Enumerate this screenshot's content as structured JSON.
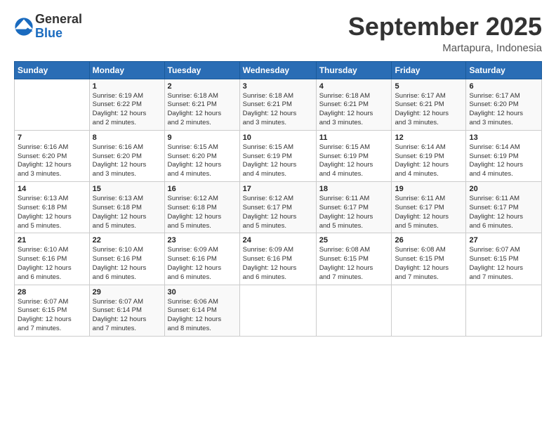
{
  "logo": {
    "general": "General",
    "blue": "Blue"
  },
  "title": "September 2025",
  "subtitle": "Martapura, Indonesia",
  "days_of_week": [
    "Sunday",
    "Monday",
    "Tuesday",
    "Wednesday",
    "Thursday",
    "Friday",
    "Saturday"
  ],
  "weeks": [
    [
      {
        "day": "",
        "info": ""
      },
      {
        "day": "1",
        "info": "Sunrise: 6:19 AM\nSunset: 6:22 PM\nDaylight: 12 hours\nand 2 minutes."
      },
      {
        "day": "2",
        "info": "Sunrise: 6:18 AM\nSunset: 6:21 PM\nDaylight: 12 hours\nand 2 minutes."
      },
      {
        "day": "3",
        "info": "Sunrise: 6:18 AM\nSunset: 6:21 PM\nDaylight: 12 hours\nand 3 minutes."
      },
      {
        "day": "4",
        "info": "Sunrise: 6:18 AM\nSunset: 6:21 PM\nDaylight: 12 hours\nand 3 minutes."
      },
      {
        "day": "5",
        "info": "Sunrise: 6:17 AM\nSunset: 6:21 PM\nDaylight: 12 hours\nand 3 minutes."
      },
      {
        "day": "6",
        "info": "Sunrise: 6:17 AM\nSunset: 6:20 PM\nDaylight: 12 hours\nand 3 minutes."
      }
    ],
    [
      {
        "day": "7",
        "info": "Sunrise: 6:16 AM\nSunset: 6:20 PM\nDaylight: 12 hours\nand 3 minutes."
      },
      {
        "day": "8",
        "info": "Sunrise: 6:16 AM\nSunset: 6:20 PM\nDaylight: 12 hours\nand 3 minutes."
      },
      {
        "day": "9",
        "info": "Sunrise: 6:15 AM\nSunset: 6:20 PM\nDaylight: 12 hours\nand 4 minutes."
      },
      {
        "day": "10",
        "info": "Sunrise: 6:15 AM\nSunset: 6:19 PM\nDaylight: 12 hours\nand 4 minutes."
      },
      {
        "day": "11",
        "info": "Sunrise: 6:15 AM\nSunset: 6:19 PM\nDaylight: 12 hours\nand 4 minutes."
      },
      {
        "day": "12",
        "info": "Sunrise: 6:14 AM\nSunset: 6:19 PM\nDaylight: 12 hours\nand 4 minutes."
      },
      {
        "day": "13",
        "info": "Sunrise: 6:14 AM\nSunset: 6:19 PM\nDaylight: 12 hours\nand 4 minutes."
      }
    ],
    [
      {
        "day": "14",
        "info": "Sunrise: 6:13 AM\nSunset: 6:18 PM\nDaylight: 12 hours\nand 5 minutes."
      },
      {
        "day": "15",
        "info": "Sunrise: 6:13 AM\nSunset: 6:18 PM\nDaylight: 12 hours\nand 5 minutes."
      },
      {
        "day": "16",
        "info": "Sunrise: 6:12 AM\nSunset: 6:18 PM\nDaylight: 12 hours\nand 5 minutes."
      },
      {
        "day": "17",
        "info": "Sunrise: 6:12 AM\nSunset: 6:17 PM\nDaylight: 12 hours\nand 5 minutes."
      },
      {
        "day": "18",
        "info": "Sunrise: 6:11 AM\nSunset: 6:17 PM\nDaylight: 12 hours\nand 5 minutes."
      },
      {
        "day": "19",
        "info": "Sunrise: 6:11 AM\nSunset: 6:17 PM\nDaylight: 12 hours\nand 5 minutes."
      },
      {
        "day": "20",
        "info": "Sunrise: 6:11 AM\nSunset: 6:17 PM\nDaylight: 12 hours\nand 6 minutes."
      }
    ],
    [
      {
        "day": "21",
        "info": "Sunrise: 6:10 AM\nSunset: 6:16 PM\nDaylight: 12 hours\nand 6 minutes."
      },
      {
        "day": "22",
        "info": "Sunrise: 6:10 AM\nSunset: 6:16 PM\nDaylight: 12 hours\nand 6 minutes."
      },
      {
        "day": "23",
        "info": "Sunrise: 6:09 AM\nSunset: 6:16 PM\nDaylight: 12 hours\nand 6 minutes."
      },
      {
        "day": "24",
        "info": "Sunrise: 6:09 AM\nSunset: 6:16 PM\nDaylight: 12 hours\nand 6 minutes."
      },
      {
        "day": "25",
        "info": "Sunrise: 6:08 AM\nSunset: 6:15 PM\nDaylight: 12 hours\nand 7 minutes."
      },
      {
        "day": "26",
        "info": "Sunrise: 6:08 AM\nSunset: 6:15 PM\nDaylight: 12 hours\nand 7 minutes."
      },
      {
        "day": "27",
        "info": "Sunrise: 6:07 AM\nSunset: 6:15 PM\nDaylight: 12 hours\nand 7 minutes."
      }
    ],
    [
      {
        "day": "28",
        "info": "Sunrise: 6:07 AM\nSunset: 6:15 PM\nDaylight: 12 hours\nand 7 minutes."
      },
      {
        "day": "29",
        "info": "Sunrise: 6:07 AM\nSunset: 6:14 PM\nDaylight: 12 hours\nand 7 minutes."
      },
      {
        "day": "30",
        "info": "Sunrise: 6:06 AM\nSunset: 6:14 PM\nDaylight: 12 hours\nand 8 minutes."
      },
      {
        "day": "",
        "info": ""
      },
      {
        "day": "",
        "info": ""
      },
      {
        "day": "",
        "info": ""
      },
      {
        "day": "",
        "info": ""
      }
    ]
  ]
}
